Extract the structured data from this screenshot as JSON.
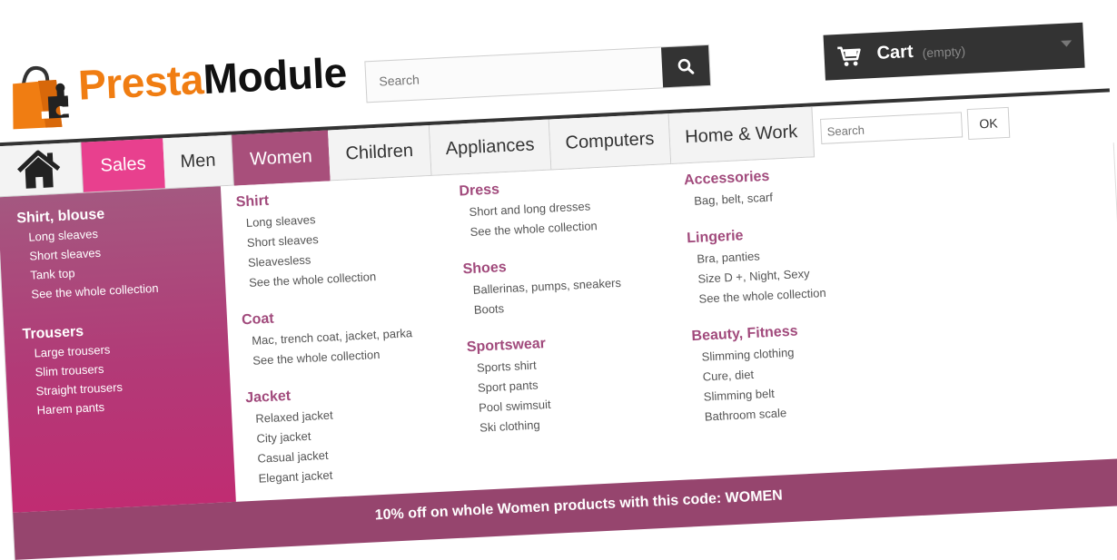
{
  "brand": {
    "logo_part1": "Presta",
    "logo_part2": "Module",
    "colors": {
      "orange": "#f07d12",
      "dark": "#333333",
      "pink": "#e8408e",
      "plum": "#a84f7b"
    }
  },
  "header": {
    "search_placeholder": "Search",
    "search_icon": "magnifier-icon",
    "cart": {
      "label": "Cart",
      "status": "(empty)",
      "icon": "cart-icon"
    }
  },
  "nav": {
    "home_icon": "home-icon",
    "items": [
      {
        "label": "Sales"
      },
      {
        "label": "Men"
      },
      {
        "label": "Women"
      },
      {
        "label": "Children"
      },
      {
        "label": "Appliances"
      },
      {
        "label": "Computers"
      },
      {
        "label": "Home & Work"
      }
    ],
    "mini_search_placeholder": "Search",
    "ok_label": "OK"
  },
  "menu": {
    "left": [
      {
        "title": "Shirt, blouse",
        "items": [
          "Long sleaves",
          "Short sleaves",
          "Tank top",
          "See the whole collection"
        ]
      },
      {
        "title": "Trousers",
        "items": [
          "Large trousers",
          "Slim trousers",
          "Straight trousers",
          "Harem pants"
        ]
      }
    ],
    "col1": [
      {
        "title": "Shirt",
        "items": [
          "Long sleaves",
          "Short sleaves",
          "Sleavesless",
          "See the whole collection"
        ]
      },
      {
        "title": "Coat",
        "items": [
          "Mac, trench coat, jacket, parka",
          "See the whole collection"
        ]
      },
      {
        "title": "Jacket",
        "items": [
          "Relaxed jacket",
          "City jacket",
          "Casual jacket",
          "Elegant jacket"
        ]
      }
    ],
    "col2": [
      {
        "title": "Dress",
        "items": [
          "Short and long dresses",
          "See the whole collection"
        ]
      },
      {
        "title": "Shoes",
        "items": [
          "Ballerinas, pumps, sneakers",
          "Boots"
        ]
      },
      {
        "title": "Sportswear",
        "items": [
          "Sports shirt",
          "Sport pants",
          "Pool swimsuit",
          "Ski clothing"
        ]
      }
    ],
    "col3": [
      {
        "title": "Accessories",
        "items": [
          "Bag, belt, scarf"
        ]
      },
      {
        "title": "Lingerie",
        "items": [
          "Bra, panties",
          "Size D +, Night, Sexy",
          "See the whole collection"
        ]
      },
      {
        "title": "Beauty, Fitness",
        "items": [
          "Slimming clothing",
          "Cure, diet",
          "Slimming belt",
          "Bathroom scale"
        ]
      }
    ]
  },
  "promo": {
    "text": "10% off on whole Women products with this code: WOMEN"
  }
}
